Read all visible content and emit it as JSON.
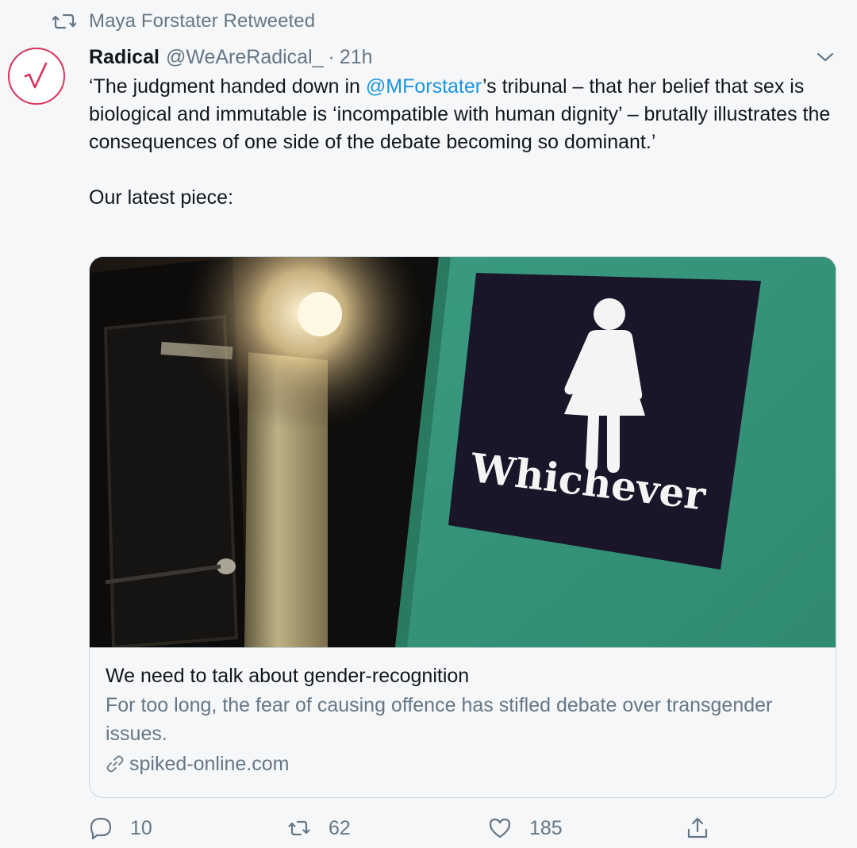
{
  "retweet_context": {
    "text": "Maya Forstater Retweeted",
    "icon": "retweet-icon"
  },
  "author": {
    "name": "Radical",
    "handle": "@WeAreRadical_",
    "separator": "·",
    "time": "21h",
    "avatar_icon": "check-mark-logo",
    "avatar_color": "#d9325c"
  },
  "tweet": {
    "line1_pre": "‘The judgment handed down in ",
    "mention": "@MForstater",
    "line1_post": "’s tribunal – that her belief that sex is biological and immutable is ‘incompatible with human dignity’ – brutally illustrates the consequences of one side of the debate becoming so dominant.’",
    "paragraph2": "Our latest piece:"
  },
  "card": {
    "image_sign_text": "Whichever",
    "title": "We need to talk about gender-recognition",
    "description": "For too long, the fear of causing offence has stifled debate over transgender issues.",
    "domain": "spiked-online.com",
    "link_icon": "link-icon"
  },
  "actions": {
    "replies": "10",
    "retweets": "62",
    "likes": "185"
  },
  "colors": {
    "mention": "#1b95e0",
    "muted": "#657786",
    "text": "#14171a",
    "background": "#f6f7f9"
  }
}
